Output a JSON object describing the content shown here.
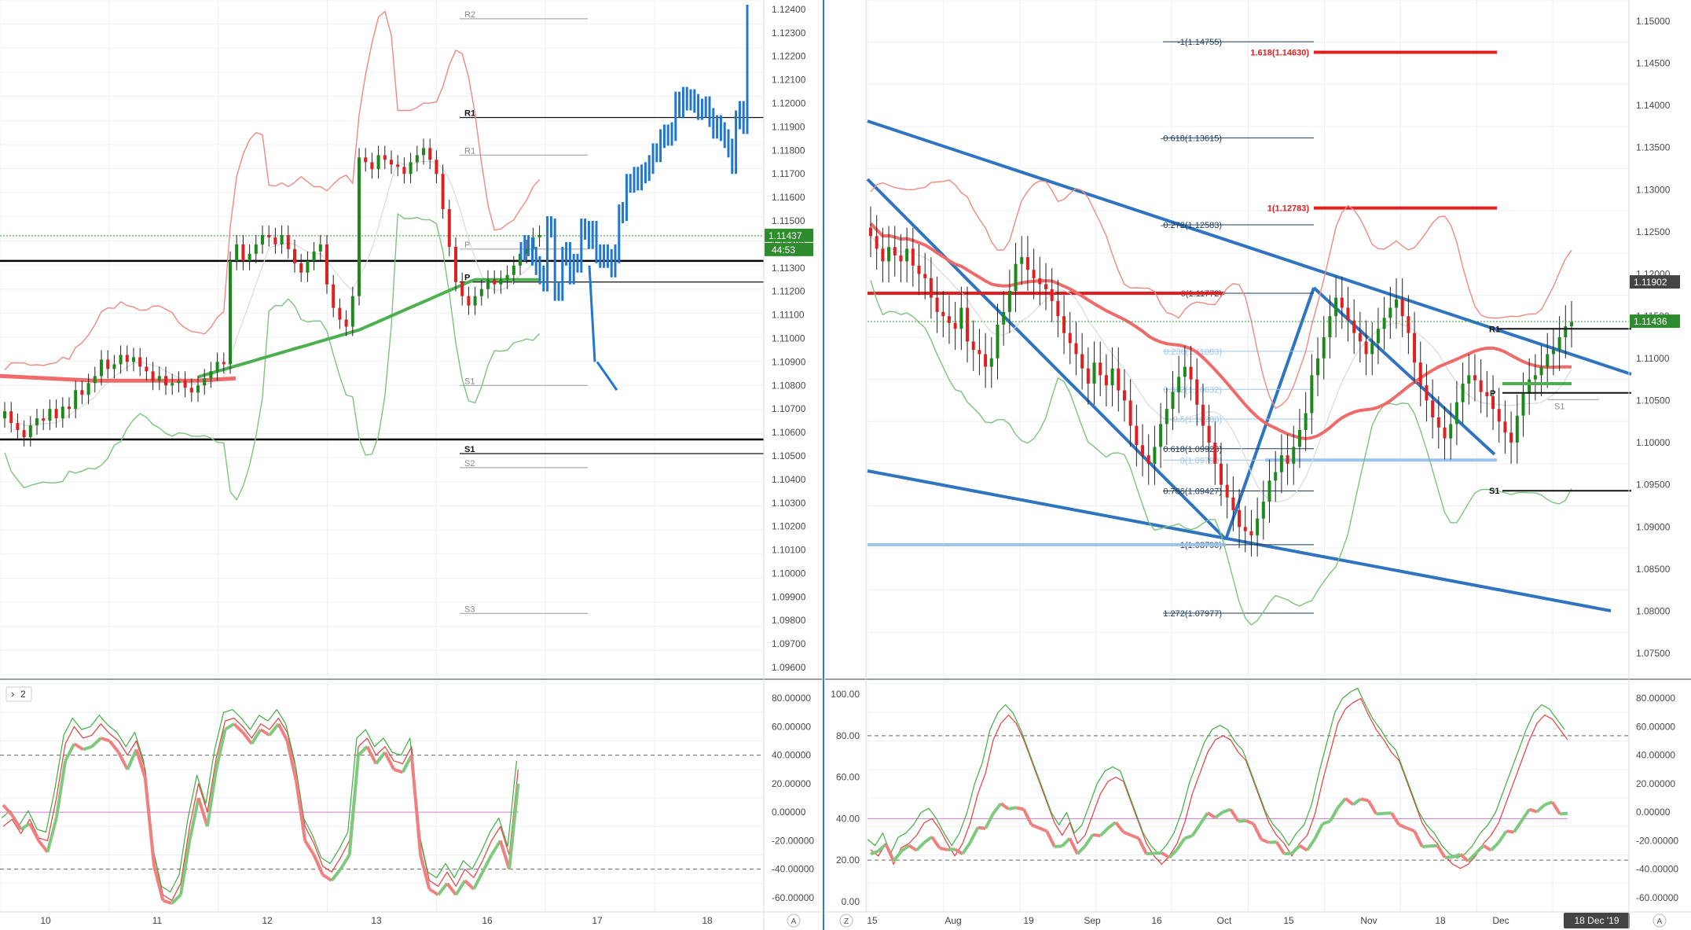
{
  "left": {
    "price_axis": [
      "1.12400",
      "1.12300",
      "1.12200",
      "1.12100",
      "1.12000",
      "1.11900",
      "1.11800",
      "1.11700",
      "1.11600",
      "1.11500",
      "1.11400",
      "1.11300",
      "1.11200",
      "1.11100",
      "1.11000",
      "1.10900",
      "1.10800",
      "1.10700",
      "1.10600",
      "1.10500",
      "1.10400",
      "1.10300",
      "1.10200",
      "1.10100",
      "1.10000",
      "1.09900",
      "1.09800",
      "1.09700",
      "1.09600"
    ],
    "price_badge": "1.11437",
    "countdown_badge": "44:53",
    "pivots": [
      {
        "label": "R2",
        "price": 1.1236,
        "bold": false
      },
      {
        "label": "R1",
        "price": 1.1194,
        "bold": true
      },
      {
        "label": "R1",
        "price": 1.1178,
        "bold": false
      },
      {
        "label": "P",
        "price": 1.1138,
        "bold": false
      },
      {
        "label": "P",
        "price": 1.1124,
        "bold": true
      },
      {
        "label": "S1",
        "price": 1.108,
        "bold": false
      },
      {
        "label": "S1",
        "price": 1.1051,
        "bold": true
      },
      {
        "label": "S2",
        "price": 1.1045,
        "bold": false
      },
      {
        "label": "S3",
        "price": 1.0983,
        "bold": false
      }
    ],
    "time_axis": [
      "10",
      "11",
      "12",
      "13",
      "16",
      "17",
      "18"
    ],
    "osc_axis": [
      "80.00000",
      "60.00000",
      "40.00000",
      "20.00000",
      "0.00000",
      "-20.00000",
      "-40.00000",
      "-60.00000"
    ],
    "osc_toggle": "2",
    "axis_mode": "A"
  },
  "right": {
    "price_axis": [
      "1.15000",
      "1.14500",
      "1.14000",
      "1.13500",
      "1.13000",
      "1.12500",
      "1.12000",
      "1.11500",
      "1.11000",
      "1.10500",
      "1.10000",
      "1.09500",
      "1.09000",
      "1.08500",
      "1.08000",
      "1.07500"
    ],
    "price_badges": [
      "1.11902",
      "1.11436"
    ],
    "fib_labels": [
      {
        "text": "-1(1.14755)",
        "price": 1.14755,
        "color": "#1f3a5a"
      },
      {
        "text": "1.618(1.14630)",
        "price": 1.1463,
        "color": "#e31e1e"
      },
      {
        "text": "-0.618(1.13615)",
        "price": 1.13615,
        "color": "#1f3a5a"
      },
      {
        "text": "1(1.12783)",
        "price": 1.12783,
        "color": "#e31e1e"
      },
      {
        "text": "-0.272(1.12583)",
        "price": 1.12583,
        "color": "#1f3a5a"
      },
      {
        "text": "0(1.11772)",
        "price": 1.11772,
        "color": "#1f3a5a"
      },
      {
        "text": "0.236(1.11083)",
        "price": 1.11083,
        "color": "#9cc3ee"
      },
      {
        "text": "0.382(1.10632)",
        "price": 1.10632,
        "color": "#9cc3ee"
      },
      {
        "text": "0.5(1.10280)",
        "price": 1.1028,
        "color": "#9cc3ee"
      },
      {
        "text": "0.618(1.09928)",
        "price": 1.09928,
        "color": "#1f3a5a"
      },
      {
        "text": "0(1.09793)",
        "price": 1.09793,
        "color": "#9cc3ee"
      },
      {
        "text": "0.786(1.09427)",
        "price": 1.09427,
        "color": "#1f3a5a"
      },
      {
        "text": "1(1.08790)",
        "price": 1.0879,
        "color": "#1f3a5a"
      },
      {
        "text": "1.272(1.07977)",
        "price": 1.07977,
        "color": "#1f3a5a"
      }
    ],
    "pivots": [
      {
        "label": "R1",
        "price": 1.1135
      },
      {
        "label": "P",
        "price": 1.1059
      },
      {
        "label": "S1",
        "price": 1.0943
      },
      {
        "label": "S1",
        "price": 1.1051
      }
    ],
    "time_axis": [
      "15",
      "Aug",
      "19",
      "Sep",
      "16",
      "Oct",
      "15",
      "Nov",
      "18",
      "Dec"
    ],
    "date_badge": "18 Dec '19",
    "osc_axis_left": [
      "100.00",
      "80.00",
      "60.00",
      "40.00",
      "20.00",
      "0.00"
    ],
    "osc_axis_right": [
      "80.00000",
      "60.00000",
      "40.00000",
      "20.00000",
      "0.00000",
      "-20.00000",
      "-40.00000",
      "-60.00000"
    ],
    "zoom_label": "Z",
    "axis_mode": "A"
  },
  "chart_data": [
    {
      "type": "candlestick",
      "title": "",
      "ylim": [
        1.0957,
        1.1244
      ],
      "x_ticks": [
        "10",
        "11",
        "12",
        "13",
        "16",
        "17",
        "18"
      ],
      "last_price": 1.11437,
      "series": [
        {
          "values": [
            1.1069,
            1.1064,
            1.1061,
            1.1058,
            1.1063,
            1.1066,
            1.1065,
            1.107,
            1.1066,
            1.1071,
            1.107,
            1.1078,
            1.1076,
            1.1081,
            1.1084,
            1.1091,
            1.1087,
            1.1089,
            1.1093,
            1.109,
            1.1092,
            1.1088,
            1.1086,
            1.1082,
            1.1084,
            1.108,
            1.1081,
            1.1082,
            1.1079,
            1.1077,
            1.108,
            1.1083,
            1.1086,
            1.109,
            1.1089,
            1.1133,
            1.114,
            1.1133,
            1.1136,
            1.114,
            1.1144,
            1.1143,
            1.114,
            1.1144,
            1.1138,
            1.1132,
            1.1128,
            1.1133,
            1.1137,
            1.114,
            1.1123,
            1.1113,
            1.1108,
            1.1105,
            1.1118,
            1.1177,
            1.1175,
            1.1172,
            1.1178,
            1.1176,
            1.1174,
            1.1173,
            1.117,
            1.1175,
            1.1178,
            1.1181,
            1.1176,
            1.117,
            1.1155,
            1.1139,
            1.1124,
            1.1118,
            1.1114,
            1.1118,
            1.1121,
            1.1125,
            1.1123,
            1.1125,
            1.1127,
            1.1131,
            1.1136,
            1.1138,
            1.1143,
            1.1144
          ]
        },
        {
          "name": "",
          "values": [
            1.1137,
            1.114,
            1.1139,
            1.1135,
            1.1131,
            1.1127,
            1.1124,
            1.1148,
            1.1147,
            1.112,
            1.112,
            1.1135,
            1.1137,
            1.1127,
            1.1132,
            1.1132,
            1.1147,
            1.1146,
            1.1142,
            1.1146,
            1.1136,
            1.1134,
            1.1136,
            1.1134,
            1.113,
            1.1136,
            1.1153,
            1.1154,
            1.1166,
            1.1166,
            1.1169,
            1.1167,
            1.117,
            1.1171,
            1.1174,
            1.1179,
            1.1179,
            1.1185,
            1.1187,
            1.1186,
            1.1188,
            1.1201,
            1.1198,
            1.1203,
            1.1201,
            1.1202,
            1.12,
            1.1197,
            1.1198,
            1.1199,
            1.1194,
            1.1189,
            1.1191,
            1.1188,
            1.1185,
            1.1181,
            1.1174,
            1.1193,
            1.1197,
            1.1191,
            1.1238
          ]
        }
      ]
    },
    {
      "type": "candlestick",
      "title": "",
      "ylim": [
        1.0725,
        1.1525
      ],
      "x_ticks": [
        "15",
        "Aug",
        "19",
        "Sep",
        "16",
        "Oct",
        "15",
        "Nov",
        "18",
        "Dec"
      ],
      "last_price": 1.11436,
      "series": [
        {
          "values": [
            1.1245,
            1.123,
            1.1215,
            1.1232,
            1.1222,
            1.1215,
            1.123,
            1.121,
            1.12,
            1.1195,
            1.1172,
            1.1155,
            1.115,
            1.1142,
            1.1135,
            1.116,
            1.112,
            1.111,
            1.1105,
            1.109,
            1.11,
            1.114,
            1.1155,
            1.118,
            1.1212,
            1.122,
            1.1205,
            1.1195,
            1.1188,
            1.1182,
            1.1168,
            1.115,
            1.113,
            1.1118,
            1.1105,
            1.1088,
            1.107,
            1.1095,
            1.108,
            1.1068,
            1.1088,
            1.1062,
            1.105,
            1.102,
            1.0997,
            1.0985,
            1.0975,
            1.0995,
            1.1022,
            1.104,
            1.106,
            1.1078,
            1.109,
            1.1075,
            1.1045,
            1.102,
            1.1,
            1.0975,
            1.095,
            1.0935,
            1.092,
            1.09,
            1.0895,
            1.089,
            1.091,
            1.093,
            1.0955,
            1.0965,
            1.0985,
            1.0975,
            1.0995,
            1.1015,
            1.1035,
            1.108,
            1.11,
            1.1125,
            1.115,
            1.1172,
            1.116,
            1.1145,
            1.113,
            1.112,
            1.1105,
            1.1118,
            1.1135,
            1.1148,
            1.116,
            1.117,
            1.115,
            1.113,
            1.1095,
            1.1068,
            1.105,
            1.103,
            1.1018,
            1.1005,
            1.1022,
            1.1048,
            1.107,
            1.108,
            1.1074,
            1.106,
            1.1055,
            1.104,
            1.1025,
            1.1012,
            1.1,
            1.1032,
            1.1058,
            1.1075,
            1.108,
            1.109,
            1.1105,
            1.111,
            1.1125,
            1.1138,
            1.1143
          ]
        }
      ]
    },
    {
      "type": "line",
      "title": "",
      "ylim": [
        -70,
        90
      ],
      "y_ticks": [
        80,
        60,
        40,
        20,
        0,
        -20,
        -40,
        -60
      ],
      "reference_lines": [
        40,
        -40
      ],
      "series": [
        {
          "name": "",
          "values": [
            5,
            -2,
            -12,
            -8,
            -20,
            -28,
            -4,
            36,
            48,
            44,
            46,
            52,
            50,
            42,
            30,
            44,
            24,
            -38,
            -62,
            -64,
            -58,
            -20,
            10,
            -10,
            30,
            58,
            62,
            56,
            48,
            58,
            54,
            62,
            50,
            22,
            -20,
            -30,
            -44,
            -48,
            -40,
            -30,
            40,
            46,
            34,
            42,
            30,
            28,
            40,
            -30,
            -54,
            -58,
            -50,
            -58,
            -48,
            -54,
            -42,
            -30,
            -20,
            -40,
            20
          ]
        },
        {
          "name": "",
          "values": [
            -10,
            -5,
            -15,
            -5,
            -18,
            -20,
            10,
            48,
            60,
            52,
            54,
            62,
            55,
            50,
            40,
            50,
            30,
            -30,
            -58,
            -62,
            -50,
            -10,
            20,
            0,
            38,
            64,
            66,
            60,
            52,
            62,
            58,
            66,
            56,
            30,
            -10,
            -22,
            -38,
            -42,
            -32,
            -20,
            46,
            52,
            40,
            46,
            36,
            34,
            46,
            -20,
            -48,
            -52,
            -42,
            -52,
            -40,
            -46,
            -34,
            -20,
            -10,
            -30,
            30
          ]
        }
      ]
    },
    {
      "type": "line",
      "title": "",
      "ylim": [
        -5,
        105
      ],
      "y_ticks": [
        100,
        80,
        60,
        40,
        20,
        0
      ],
      "reference_lines": [
        80,
        20
      ],
      "series": [
        {
          "name": "",
          "values": [
            30,
            28,
            32,
            20,
            28,
            30,
            35,
            40,
            42,
            38,
            30,
            25,
            30,
            40,
            55,
            65,
            80,
            88,
            92,
            88,
            80,
            70,
            60,
            50,
            40,
            35,
            40,
            30,
            35,
            45,
            55,
            60,
            62,
            60,
            50,
            40,
            30,
            25,
            20,
            25,
            30,
            40,
            55,
            65,
            75,
            80,
            82,
            80,
            75,
            70,
            60,
            50,
            40,
            35,
            30,
            25,
            30,
            35,
            45,
            60,
            75,
            88,
            95,
            98,
            100,
            92,
            85,
            80,
            75,
            70,
            60,
            50,
            40,
            35,
            30,
            25,
            20,
            18,
            20,
            25,
            30,
            35,
            40,
            50,
            60,
            70,
            80,
            88,
            92,
            90,
            85,
            80
          ]
        },
        {
          "name": "",
          "values": [
            25,
            22,
            28,
            18,
            26,
            28,
            32,
            38,
            40,
            35,
            28,
            22,
            28,
            38,
            52,
            62,
            78,
            86,
            90,
            86,
            78,
            68,
            58,
            48,
            38,
            32,
            38,
            28,
            32,
            42,
            52,
            58,
            60,
            58,
            48,
            38,
            28,
            22,
            18,
            22,
            28,
            38,
            52,
            62,
            72,
            78,
            80,
            78,
            72,
            68,
            58,
            48,
            38,
            32,
            28,
            22,
            28,
            32,
            42,
            58,
            72,
            86,
            93,
            96,
            98,
            90,
            83,
            78,
            72,
            68,
            58,
            48,
            38,
            32,
            28,
            22,
            18,
            16,
            18,
            22,
            28,
            32,
            38,
            48,
            58,
            68,
            78,
            86,
            90,
            88,
            83,
            78
          ]
        }
      ]
    }
  ]
}
